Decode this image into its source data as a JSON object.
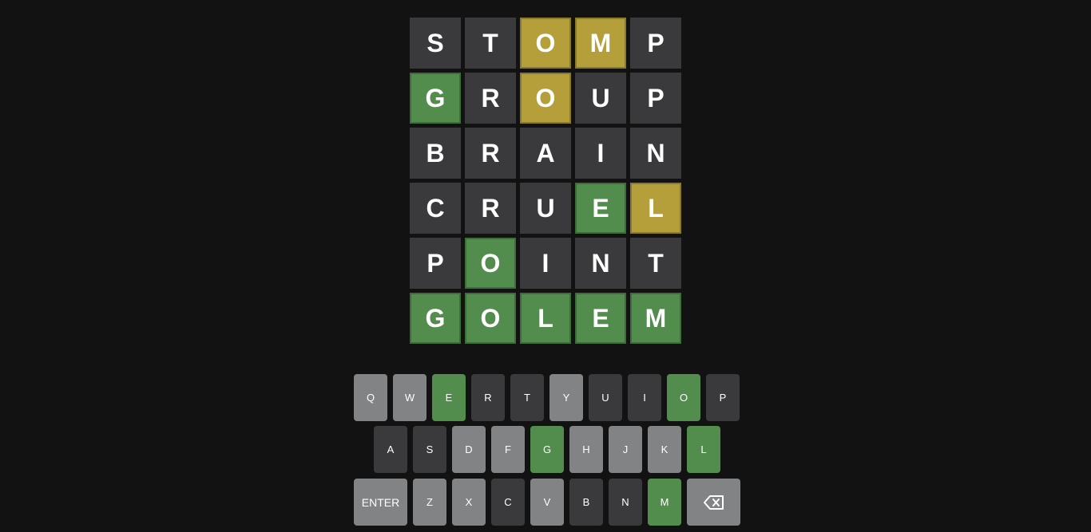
{
  "board": {
    "rows": [
      [
        {
          "letter": "S",
          "state": "absent"
        },
        {
          "letter": "T",
          "state": "absent"
        },
        {
          "letter": "O",
          "state": "present"
        },
        {
          "letter": "M",
          "state": "present"
        },
        {
          "letter": "P",
          "state": "absent"
        }
      ],
      [
        {
          "letter": "G",
          "state": "correct"
        },
        {
          "letter": "R",
          "state": "absent"
        },
        {
          "letter": "O",
          "state": "present"
        },
        {
          "letter": "U",
          "state": "absent"
        },
        {
          "letter": "P",
          "state": "absent"
        }
      ],
      [
        {
          "letter": "B",
          "state": "absent"
        },
        {
          "letter": "R",
          "state": "absent"
        },
        {
          "letter": "A",
          "state": "absent"
        },
        {
          "letter": "I",
          "state": "absent"
        },
        {
          "letter": "N",
          "state": "absent"
        }
      ],
      [
        {
          "letter": "C",
          "state": "absent"
        },
        {
          "letter": "R",
          "state": "absent"
        },
        {
          "letter": "U",
          "state": "absent"
        },
        {
          "letter": "E",
          "state": "correct"
        },
        {
          "letter": "L",
          "state": "present"
        }
      ],
      [
        {
          "letter": "P",
          "state": "absent"
        },
        {
          "letter": "O",
          "state": "correct"
        },
        {
          "letter": "I",
          "state": "absent"
        },
        {
          "letter": "N",
          "state": "absent"
        },
        {
          "letter": "T",
          "state": "absent"
        }
      ],
      [
        {
          "letter": "G",
          "state": "correct"
        },
        {
          "letter": "O",
          "state": "correct"
        },
        {
          "letter": "L",
          "state": "correct"
        },
        {
          "letter": "E",
          "state": "correct"
        },
        {
          "letter": "M",
          "state": "correct"
        }
      ]
    ]
  },
  "keyboard": {
    "rows": [
      [
        {
          "label": "Q",
          "state": "unused"
        },
        {
          "label": "W",
          "state": "unused"
        },
        {
          "label": "E",
          "state": "correct"
        },
        {
          "label": "R",
          "state": "absent"
        },
        {
          "label": "T",
          "state": "absent"
        },
        {
          "label": "Y",
          "state": "unused"
        },
        {
          "label": "U",
          "state": "absent"
        },
        {
          "label": "I",
          "state": "absent"
        },
        {
          "label": "O",
          "state": "correct"
        },
        {
          "label": "P",
          "state": "absent"
        }
      ],
      [
        {
          "label": "A",
          "state": "absent"
        },
        {
          "label": "S",
          "state": "absent"
        },
        {
          "label": "D",
          "state": "unused"
        },
        {
          "label": "F",
          "state": "unused"
        },
        {
          "label": "G",
          "state": "correct"
        },
        {
          "label": "H",
          "state": "unused"
        },
        {
          "label": "J",
          "state": "unused"
        },
        {
          "label": "K",
          "state": "unused"
        },
        {
          "label": "L",
          "state": "correct"
        }
      ],
      [
        {
          "label": "ENTER",
          "state": "unused",
          "kind": "enter"
        },
        {
          "label": "Z",
          "state": "unused"
        },
        {
          "label": "X",
          "state": "unused"
        },
        {
          "label": "C",
          "state": "absent"
        },
        {
          "label": "V",
          "state": "unused"
        },
        {
          "label": "B",
          "state": "absent"
        },
        {
          "label": "N",
          "state": "absent"
        },
        {
          "label": "M",
          "state": "correct"
        },
        {
          "label": "",
          "state": "unused",
          "kind": "backspace",
          "icon": "backspace-icon"
        }
      ]
    ]
  },
  "colors": {
    "background": "#121213",
    "absent": "#3a3a3c",
    "present": "#b59f3b",
    "correct": "#538d4e",
    "unused_key": "#818384",
    "text": "#ffffff"
  }
}
